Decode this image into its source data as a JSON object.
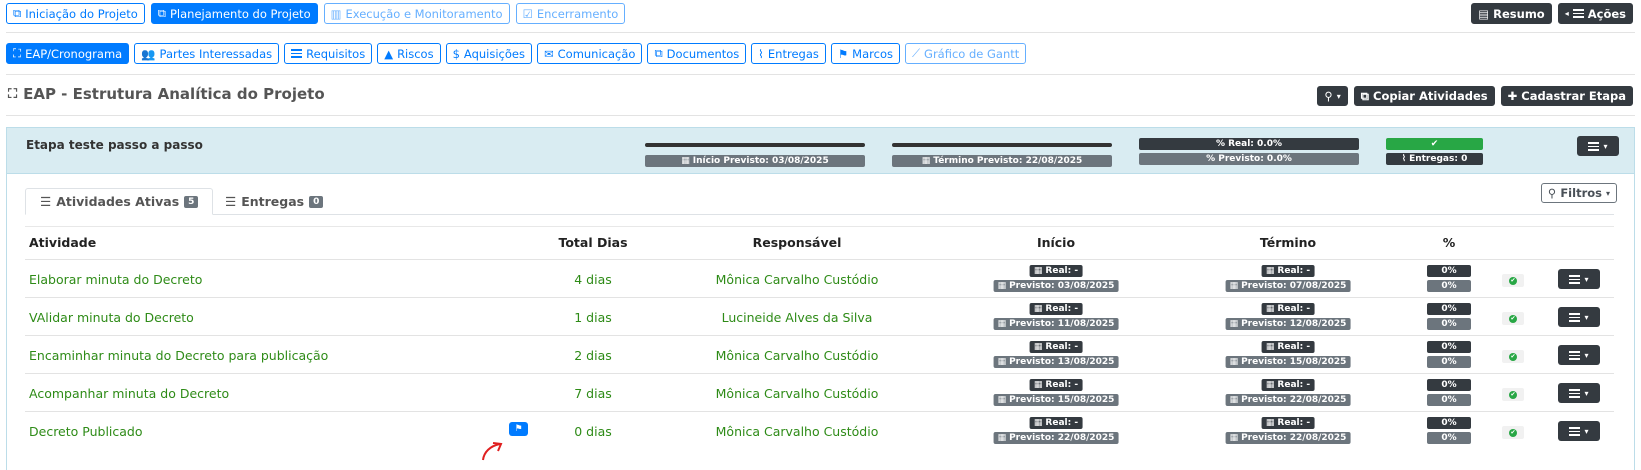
{
  "phases": [
    {
      "label": "Iniciação do Projeto",
      "icon": "copy-icon",
      "style": "outline"
    },
    {
      "label": "Planejamento do Projeto",
      "icon": "copy-icon",
      "style": "primary"
    },
    {
      "label": "Execução e Monitoramento",
      "icon": "bar-chart-icon",
      "style": "disabled"
    },
    {
      "label": "Encerramento",
      "icon": "check-square-icon",
      "style": "disabled"
    }
  ],
  "top_actions": {
    "summary": "Resumo",
    "actions": "Ações"
  },
  "tabs": [
    {
      "label": "EAP/Cronograma",
      "icon": "sitemap-icon",
      "active": true
    },
    {
      "label": "Partes Interessadas",
      "icon": "users-icon"
    },
    {
      "label": "Requisitos",
      "icon": "list-icon"
    },
    {
      "label": "Riscos",
      "icon": "warning-icon"
    },
    {
      "label": "Aquisições",
      "icon": "dollar-icon"
    },
    {
      "label": "Comunicação",
      "icon": "envelope-icon"
    },
    {
      "label": "Documentos",
      "icon": "copy-icon"
    },
    {
      "label": "Entregas",
      "icon": "paperclip-icon"
    },
    {
      "label": "Marcos",
      "icon": "flag-icon"
    },
    {
      "label": "Gráfico de Gantt",
      "icon": "line-chart-icon",
      "disabled": true
    }
  ],
  "page": {
    "title": "EAP - Estrutura Analítica do Projeto",
    "copy_label": "Copiar Atividades",
    "add_stage_label": "Cadastrar Etapa"
  },
  "stage": {
    "name": "Etapa teste passo a passo",
    "start_planned": "Início Previsto: 03/08/2025",
    "end_planned": "Término Previsto: 22/08/2025",
    "real_pct": "% Real: 0.0%",
    "planned_pct": "% Previsto: 0.0%",
    "deliveries": "Entregas: 0"
  },
  "subtabs": {
    "active_label": "Atividades Ativas",
    "active_count": "5",
    "deliveries_label": "Entregas",
    "deliveries_count": "0",
    "filters": "Filtros"
  },
  "table": {
    "headers": {
      "activity": "Atividade",
      "total_days": "Total Dias",
      "responsible": "Responsável",
      "start": "Início",
      "end": "Término",
      "pct": "%"
    },
    "rows": [
      {
        "activity": "Elaborar minuta do Decreto",
        "days": "4 dias",
        "responsible": "Mônica Carvalho Custódio",
        "start_real": "Real: -",
        "start_planned": "Previsto: 03/08/2025",
        "end_real": "Real: -",
        "end_planned": "Previsto: 07/08/2025",
        "pct_real": "0%",
        "pct_planned": "0%"
      },
      {
        "activity": "VAlidar minuta do Decreto",
        "days": "1 dias",
        "responsible": "Lucineide Alves da Silva",
        "start_real": "Real: -",
        "start_planned": "Previsto: 11/08/2025",
        "end_real": "Real: -",
        "end_planned": "Previsto: 12/08/2025",
        "pct_real": "0%",
        "pct_planned": "0%"
      },
      {
        "activity": "Encaminhar minuta do Decreto para publicação",
        "days": "2 dias",
        "responsible": "Mônica Carvalho Custódio",
        "start_real": "Real: -",
        "start_planned": "Previsto: 13/08/2025",
        "end_real": "Real: -",
        "end_planned": "Previsto: 15/08/2025",
        "pct_real": "0%",
        "pct_planned": "0%"
      },
      {
        "activity": "Acompanhar minuta do Decreto",
        "days": "7 dias",
        "responsible": "Mônica Carvalho Custódio",
        "start_real": "Real: -",
        "start_planned": "Previsto: 15/08/2025",
        "end_real": "Real: -",
        "end_planned": "Previsto: 22/08/2025",
        "pct_real": "0%",
        "pct_planned": "0%"
      },
      {
        "activity": "Decreto Publicado",
        "days": "0 dias",
        "responsible": "Mônica Carvalho Custódio",
        "start_real": "Real: -",
        "start_planned": "Previsto: 22/08/2025",
        "end_real": "Real: -",
        "end_planned": "Previsto: 22/08/2025",
        "pct_real": "0%",
        "pct_planned": "0%",
        "milestone": true
      }
    ]
  },
  "colors": {
    "primary": "#007bff",
    "dark": "#343a40",
    "gray": "#6c757d",
    "green": "#28a745",
    "activity_text": "#2e8b17",
    "stage_bg": "#d9ecf2"
  }
}
